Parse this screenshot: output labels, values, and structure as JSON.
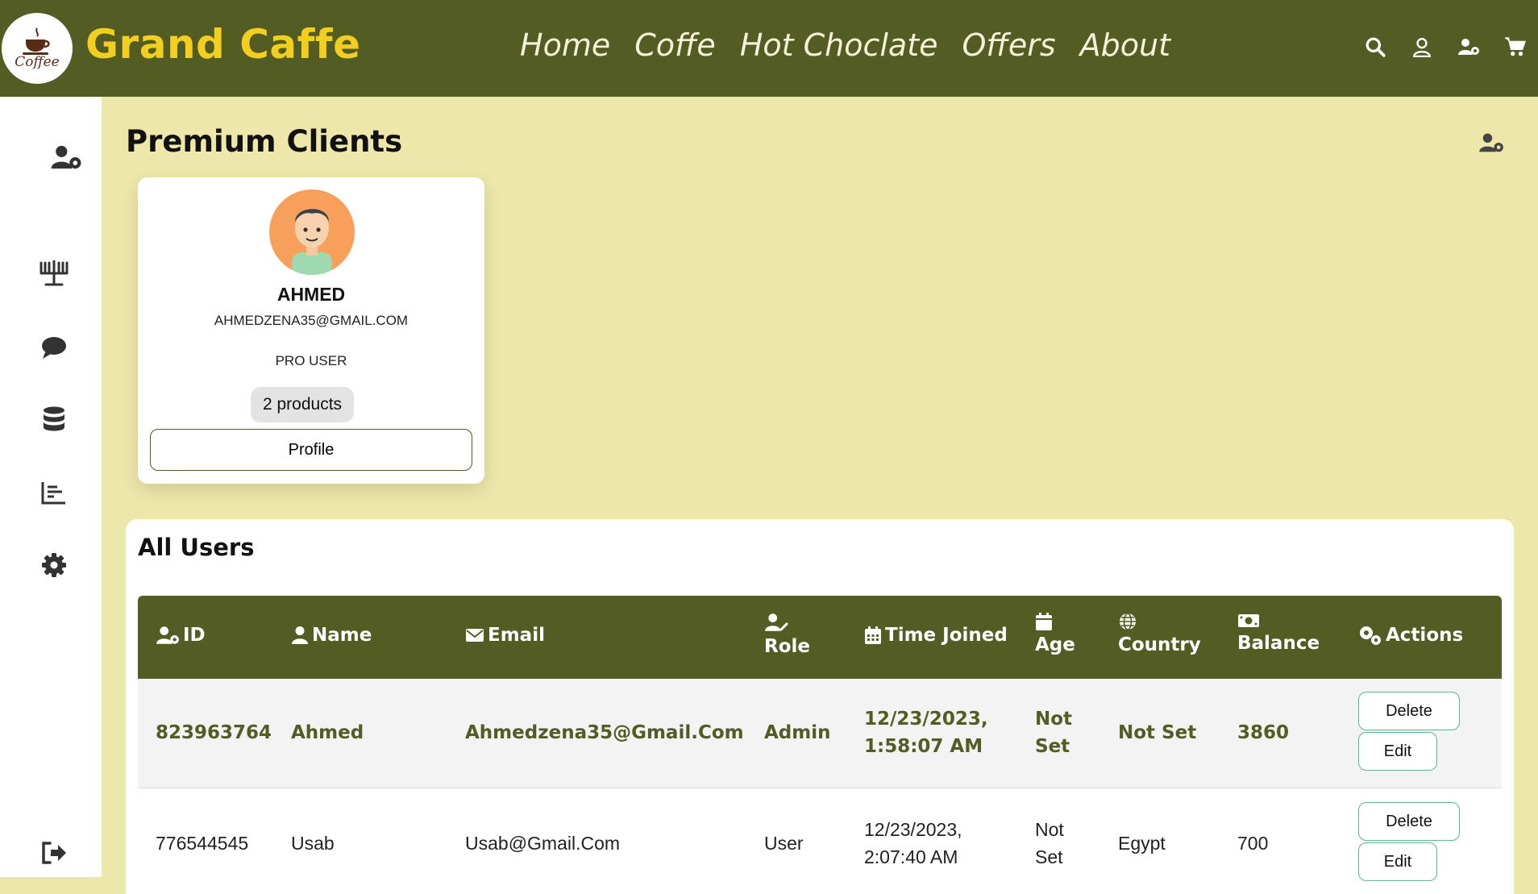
{
  "header": {
    "logo_text": "Coffee",
    "brand": "Grand Caffe",
    "nav": [
      "Home",
      "Coffe",
      "Hot Choclate",
      "Offers",
      "About"
    ],
    "icons": [
      "search-icon",
      "user-icon",
      "user-gear-icon",
      "cart-icon"
    ]
  },
  "sidebar": {
    "icons": [
      "user-gear-icon",
      "menorah-icon",
      "comment-icon",
      "database-icon",
      "chart-bar-icon",
      "gear-icon",
      "logout-icon"
    ]
  },
  "page": {
    "title": "Premium Clients"
  },
  "client_card": {
    "name": "AHMED",
    "email": "AHMEDZENA35@GMAIL.COM",
    "role": "PRO USER",
    "products": "2 products",
    "profile_label": "Profile"
  },
  "users": {
    "title": "All Users",
    "columns": [
      "ID",
      "Name",
      "Email",
      "Role",
      "Time Joined",
      "Age",
      "Country",
      "Balance",
      "Actions"
    ],
    "rows": [
      {
        "id": "823963764",
        "name": "Ahmed",
        "email": "Ahmedzena35@Gmail.Com",
        "role": "Admin",
        "time1": "12/23/2023,",
        "time2": "1:58:07 AM",
        "age1": "Not",
        "age2": "Set",
        "country": "Not Set",
        "balance": "3860"
      },
      {
        "id": "776544545",
        "name": "Usab",
        "email": "Usab@Gmail.Com",
        "role": "User",
        "time1": "12/23/2023,",
        "time2": "2:07:40 AM",
        "age1": "Not",
        "age2": "Set",
        "country": "Egypt",
        "balance": "700"
      }
    ],
    "delete_label": "Delete",
    "edit_label": "Edit"
  },
  "colors": {
    "header_bg": "#525c23",
    "brand": "#f2cf1e",
    "page_bg": "#ede7a9",
    "action_border": "#58b98a"
  }
}
